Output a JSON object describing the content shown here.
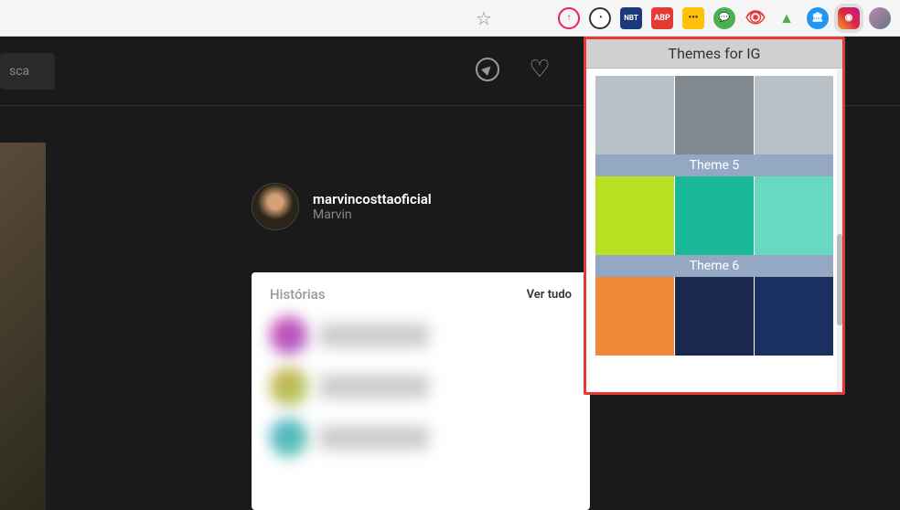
{
  "browser": {
    "star": "☆",
    "extensions": {
      "upload": "↑",
      "speed": "◔",
      "nbt": "NBT",
      "abp": "ABP",
      "dots": "•••",
      "green": "💬",
      "eye": "👁",
      "triangle": "▲",
      "bank": "🏛",
      "ig": "◉"
    }
  },
  "search": {
    "placeholder": "sca"
  },
  "profile": {
    "username": "marvincosttaoficial",
    "name": "Marvin"
  },
  "stories": {
    "title": "Histórias",
    "see_all": "Ver tudo"
  },
  "themes_popup": {
    "title": "Themes for IG",
    "themes": [
      {
        "label": "Theme 5",
        "colors": [
          "#b8c0c8",
          "#808890",
          "#b8c0c8"
        ]
      },
      {
        "label": "Theme 6",
        "colors": [
          "#b8e020",
          "#18b898",
          "#68d8c0"
        ]
      },
      {
        "label": "",
        "colors": [
          "#f08838",
          "#1a2850",
          "#1a3060"
        ]
      }
    ]
  }
}
